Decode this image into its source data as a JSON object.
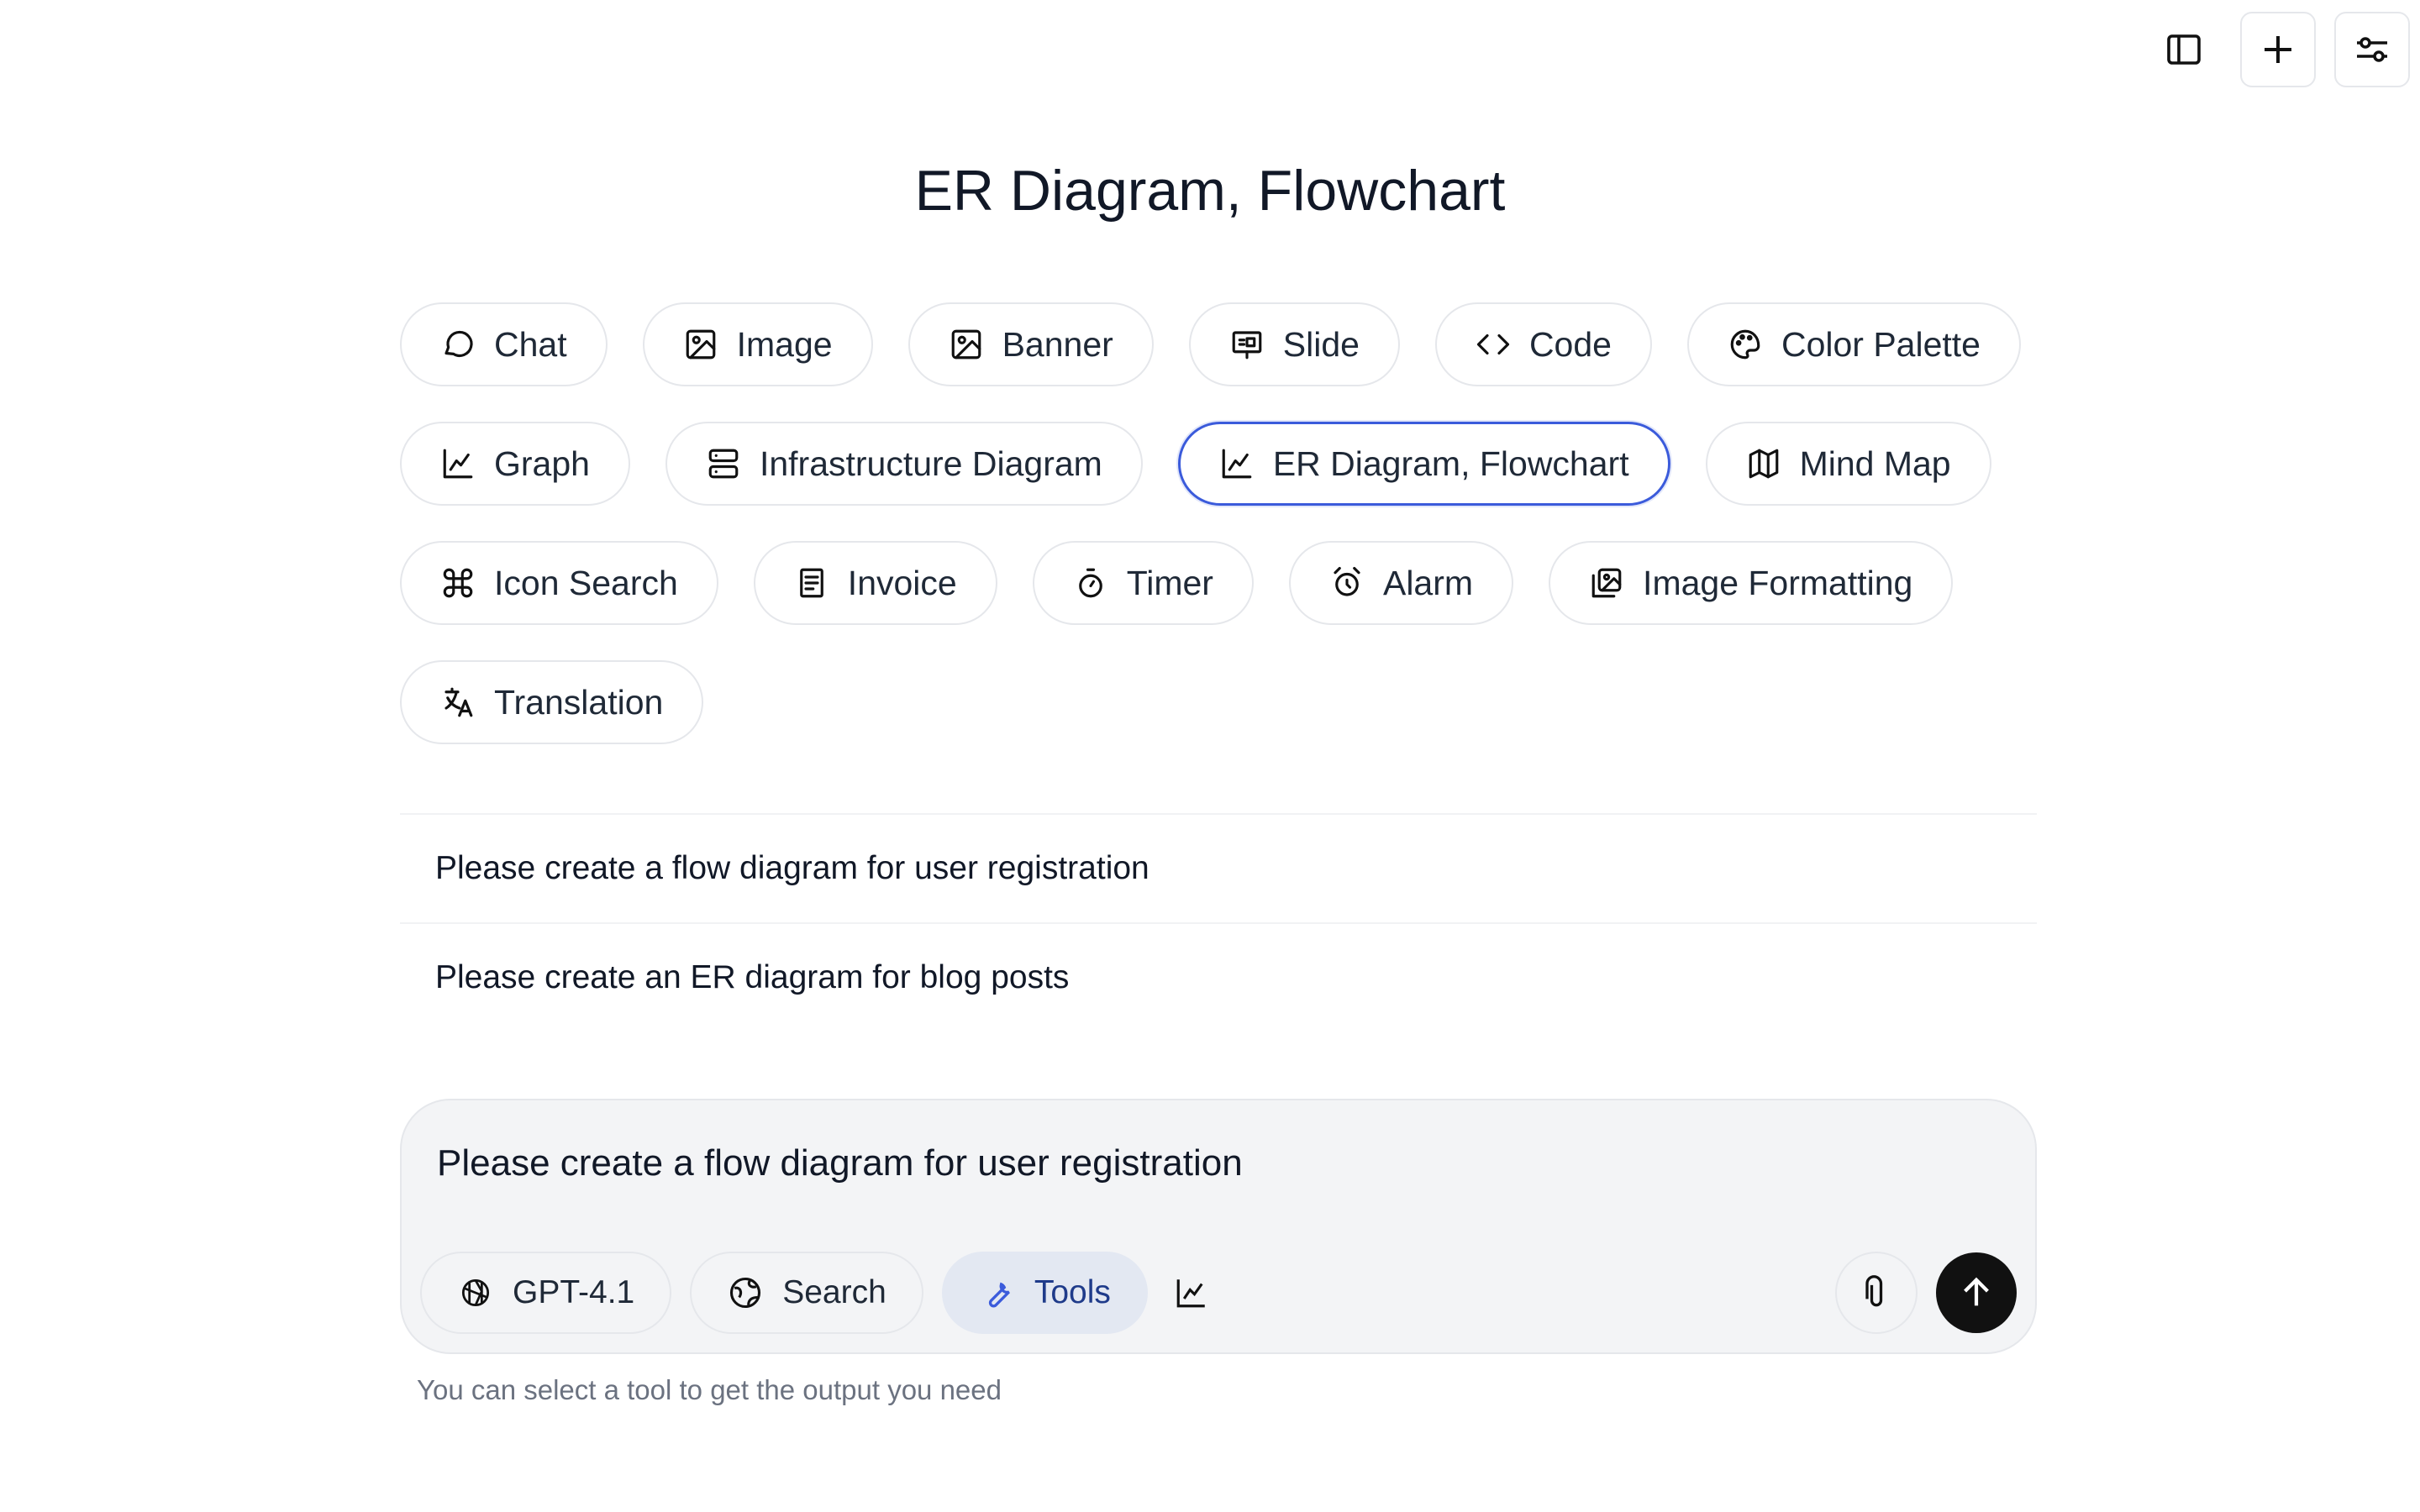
{
  "topbar": {
    "sidebar_toggle": "sidebar-toggle-icon",
    "new_chat": "plus-icon",
    "settings": "sliders-icon"
  },
  "page_title": "ER Diagram, Flowchart",
  "tools": [
    {
      "label": "Chat",
      "icon": "chat-bubble-icon"
    },
    {
      "label": "Image",
      "icon": "image-icon"
    },
    {
      "label": "Banner",
      "icon": "banner-icon"
    },
    {
      "label": "Slide",
      "icon": "presentation-icon"
    },
    {
      "label": "Code",
      "icon": "code-icon"
    },
    {
      "label": "Color Palette",
      "icon": "palette-icon"
    },
    {
      "label": "Graph",
      "icon": "line-chart-icon"
    },
    {
      "label": "Infrastructure Diagram",
      "icon": "server-icon"
    },
    {
      "label": "ER Diagram, Flowchart",
      "icon": "line-chart-icon",
      "active": true
    },
    {
      "label": "Mind Map",
      "icon": "map-icon"
    },
    {
      "label": "Icon Search",
      "icon": "command-icon"
    },
    {
      "label": "Invoice",
      "icon": "document-icon"
    },
    {
      "label": "Timer",
      "icon": "stopwatch-icon"
    },
    {
      "label": "Alarm",
      "icon": "alarm-clock-icon"
    },
    {
      "label": "Image Formatting",
      "icon": "images-icon"
    },
    {
      "label": "Translation",
      "icon": "translate-icon"
    }
  ],
  "suggestions": [
    "Please create a flow diagram for user registration",
    "Please create an ER diagram for blog posts"
  ],
  "composer": {
    "text": "Please create a flow diagram for user registration",
    "model_label": "GPT-4.1",
    "search_label": "Search",
    "tools_label": "Tools"
  },
  "hint": "You can select a tool to get the output you need",
  "colors": {
    "active_border": "#3b5bdb",
    "tools_pill_bg": "#e3e8f2",
    "send_bg": "#111111"
  }
}
